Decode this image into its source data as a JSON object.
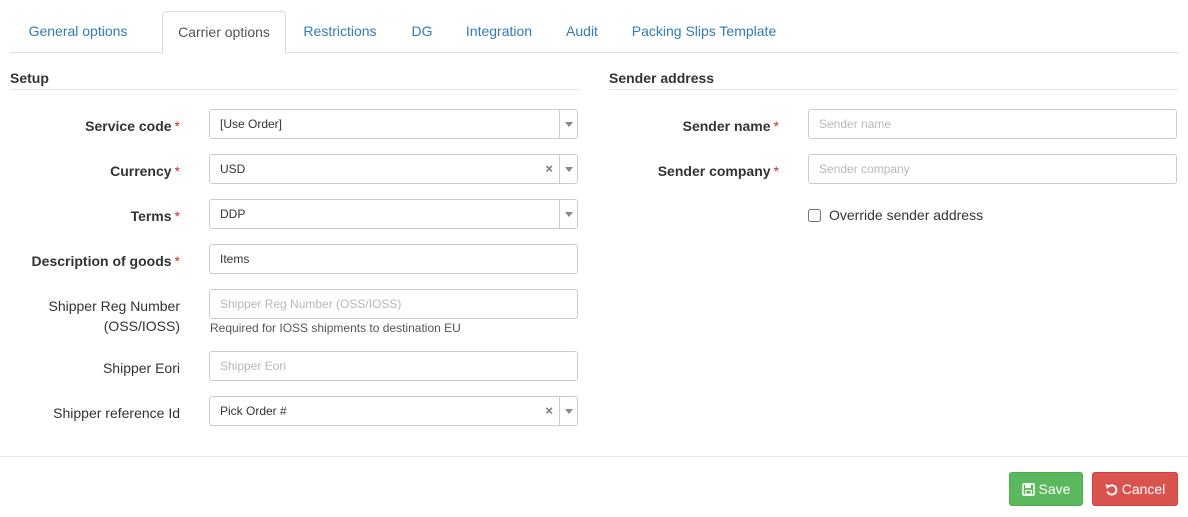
{
  "tabs": [
    {
      "label": "General options"
    },
    {
      "label": "Carrier options"
    },
    {
      "label": "Restrictions"
    },
    {
      "label": "DG"
    },
    {
      "label": "Integration"
    },
    {
      "label": "Audit"
    },
    {
      "label": "Packing Slips Template"
    }
  ],
  "active_tab": "Carrier options",
  "setup": {
    "title": "Setup",
    "service_code": {
      "label": "Service code",
      "value": "[Use Order]"
    },
    "currency": {
      "label": "Currency",
      "value": "USD"
    },
    "terms": {
      "label": "Terms",
      "value": "DDP"
    },
    "description": {
      "label": "Description of goods",
      "value": "Items"
    },
    "shipper_reg": {
      "label_line1": "Shipper Reg Number",
      "label_line2": "(OSS/IOSS)",
      "placeholder": "Shipper Reg Number (OSS/IOSS)",
      "help": "Required for IOSS shipments to destination EU"
    },
    "shipper_eori": {
      "label": "Shipper Eori",
      "placeholder": "Shipper Eori"
    },
    "shipper_ref": {
      "label": "Shipper reference Id",
      "value": "Pick Order #"
    }
  },
  "sender": {
    "title": "Sender address",
    "name": {
      "label": "Sender name",
      "placeholder": "Sender name"
    },
    "company": {
      "label": "Sender company",
      "placeholder": "Sender company"
    },
    "override": {
      "label": "Override sender address",
      "checked": false
    }
  },
  "required_mark": "*",
  "clear_glyph": "×",
  "buttons": {
    "save": "Save",
    "cancel": "Cancel"
  },
  "colors": {
    "link": "#337ab7",
    "required": "#c9302c",
    "save": "#5cb85c",
    "cancel": "#d9534f"
  }
}
